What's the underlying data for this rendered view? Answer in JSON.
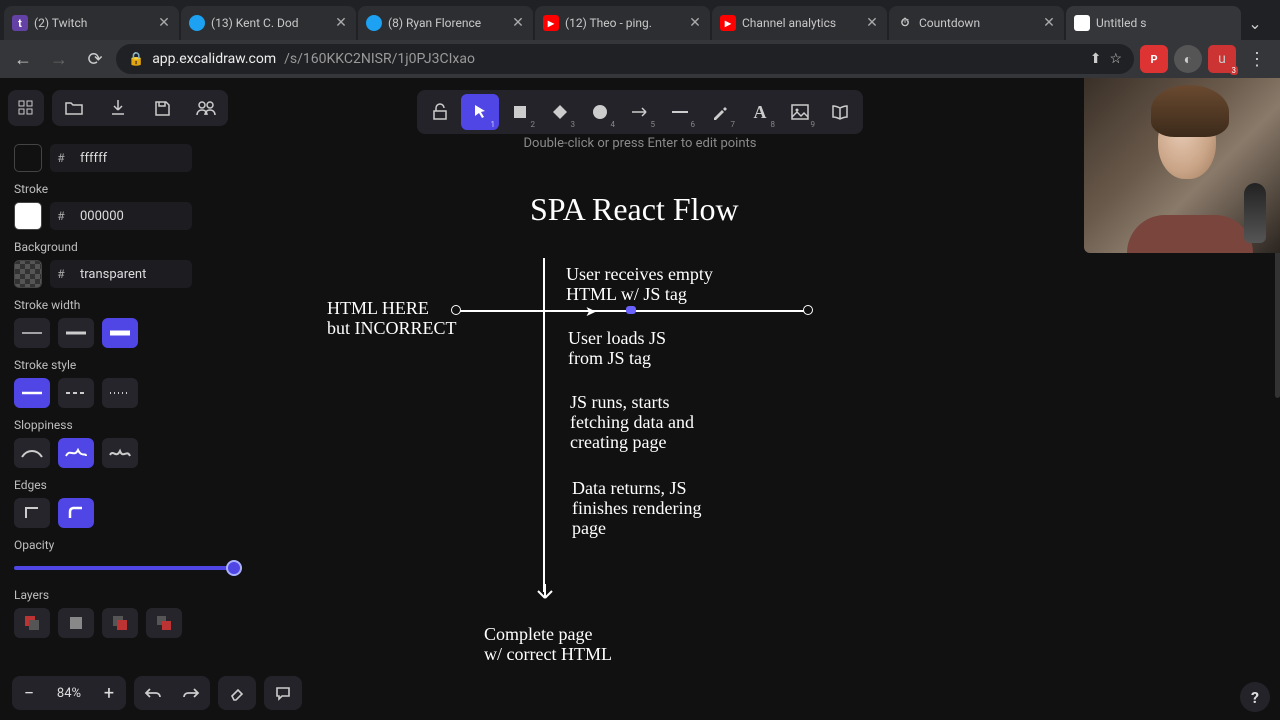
{
  "browser": {
    "tabs": [
      {
        "label": "(2) Twitch",
        "fav_bg": "#6441a5",
        "fav_txt": "t"
      },
      {
        "label": "(13) Kent C. Dod",
        "fav_bg": "#1da1f2",
        "fav_txt": ""
      },
      {
        "label": "(8) Ryan Florence",
        "fav_bg": "#1da1f2",
        "fav_txt": ""
      },
      {
        "label": "(12) Theo - ping.",
        "fav_bg": "#ff0000",
        "fav_txt": "▶"
      },
      {
        "label": "Channel analytics",
        "fav_bg": "#ff0000",
        "fav_txt": "▶"
      },
      {
        "label": "Countdown",
        "fav_bg": "#888888",
        "fav_txt": "⏱"
      },
      {
        "label": "Untitled s",
        "fav_bg": "#ffffff",
        "fav_txt": ""
      }
    ],
    "tab_close": "✕",
    "tab_dropdown": "⌄",
    "url_host": "app.excalidraw.com",
    "url_path": "/s/160KKC2NISR/1j0PJ3CIxao",
    "ext_badge": "3"
  },
  "toolbar": {
    "hint": "Double-click or press Enter to edit points",
    "tools": [
      "lock",
      "select",
      "rectangle",
      "diamond",
      "ellipse",
      "arrow",
      "line",
      "draw",
      "text",
      "image",
      "library"
    ],
    "nums": [
      "",
      "1",
      "2",
      "3",
      "4",
      "5",
      "6",
      "7",
      "8",
      "9",
      ""
    ]
  },
  "panel": {
    "stroke_label": "Stroke",
    "stroke_swatch": "#ffffff",
    "stroke_hex": "000000",
    "top_hex": "ffffff",
    "bg_label": "Background",
    "bg_hex": "transparent",
    "stroke_width_label": "Stroke width",
    "stroke_style_label": "Stroke style",
    "sloppiness_label": "Sloppiness",
    "edges_label": "Edges",
    "opacity_label": "Opacity",
    "layers_label": "Layers"
  },
  "zoom": {
    "minus": "−",
    "plus": "+",
    "value": "84%"
  },
  "help": "?",
  "drawing": {
    "title": "SPA React Flow",
    "left1": "HTML HERE",
    "left2": "but INCORRECT",
    "step1a": "User receives empty",
    "step1b": "HTML w/ JS tag",
    "step2a": "User loads JS",
    "step2b": "from JS tag",
    "step3a": "JS runs, starts",
    "step3b": "fetching data and",
    "step3c": "creating page",
    "step4a": "Data returns, JS",
    "step4b": "finishes rendering",
    "step4c": "page",
    "done1": "Complete page",
    "done2": "w/ correct HTML"
  }
}
